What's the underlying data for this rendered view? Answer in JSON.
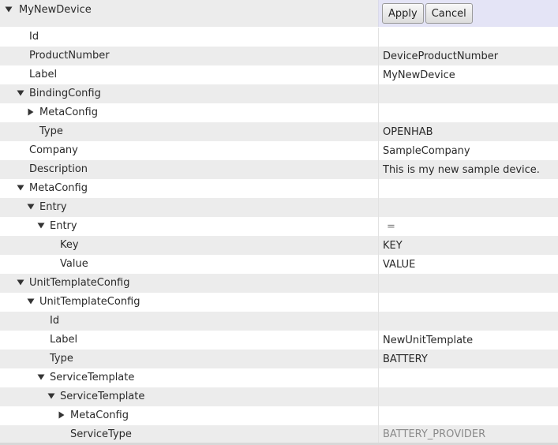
{
  "header": {
    "label": "MyNewDevice",
    "apply_label": "Apply",
    "cancel_label": "Cancel"
  },
  "rows": [
    {
      "name": "id",
      "label": "Id",
      "value": ""
    },
    {
      "name": "product-number",
      "label": "ProductNumber",
      "value": "DeviceProductNumber"
    },
    {
      "name": "label",
      "label": "Label",
      "value": "MyNewDevice"
    },
    {
      "name": "binding-config",
      "label": "BindingConfig",
      "value": "",
      "arrow": "expanded"
    },
    {
      "name": "binding-meta-config",
      "label": "MetaConfig",
      "value": "",
      "arrow": "collapsed"
    },
    {
      "name": "binding-type",
      "label": "Type",
      "value": "OPENHAB"
    },
    {
      "name": "company",
      "label": "Company",
      "value": "SampleCompany"
    },
    {
      "name": "description",
      "label": "Description",
      "value": "This is my new sample device."
    },
    {
      "name": "meta-config",
      "label": "MetaConfig",
      "value": "",
      "arrow": "expanded"
    },
    {
      "name": "entry-list",
      "label": "Entry",
      "value": "",
      "arrow": "expanded"
    },
    {
      "name": "entry",
      "label": "Entry",
      "value": "=",
      "arrow": "expanded"
    },
    {
      "name": "entry-key",
      "label": "Key",
      "value": "KEY"
    },
    {
      "name": "entry-value",
      "label": "Value",
      "value": "VALUE"
    },
    {
      "name": "unit-template-config-list",
      "label": "UnitTemplateConfig",
      "value": "",
      "arrow": "expanded"
    },
    {
      "name": "unit-template-config",
      "label": "UnitTemplateConfig",
      "value": "",
      "arrow": "expanded"
    },
    {
      "name": "unit-id",
      "label": "Id",
      "value": ""
    },
    {
      "name": "unit-label",
      "label": "Label",
      "value": "NewUnitTemplate"
    },
    {
      "name": "unit-type",
      "label": "Type",
      "value": "BATTERY"
    },
    {
      "name": "service-template-list",
      "label": "ServiceTemplate",
      "value": "",
      "arrow": "expanded"
    },
    {
      "name": "service-template",
      "label": "ServiceTemplate",
      "value": "",
      "arrow": "expanded"
    },
    {
      "name": "service-meta-config",
      "label": "MetaConfig",
      "value": "",
      "arrow": "collapsed"
    },
    {
      "name": "service-type",
      "label": "ServiceType",
      "value": "BATTERY_PROVIDER",
      "muted": true
    }
  ]
}
